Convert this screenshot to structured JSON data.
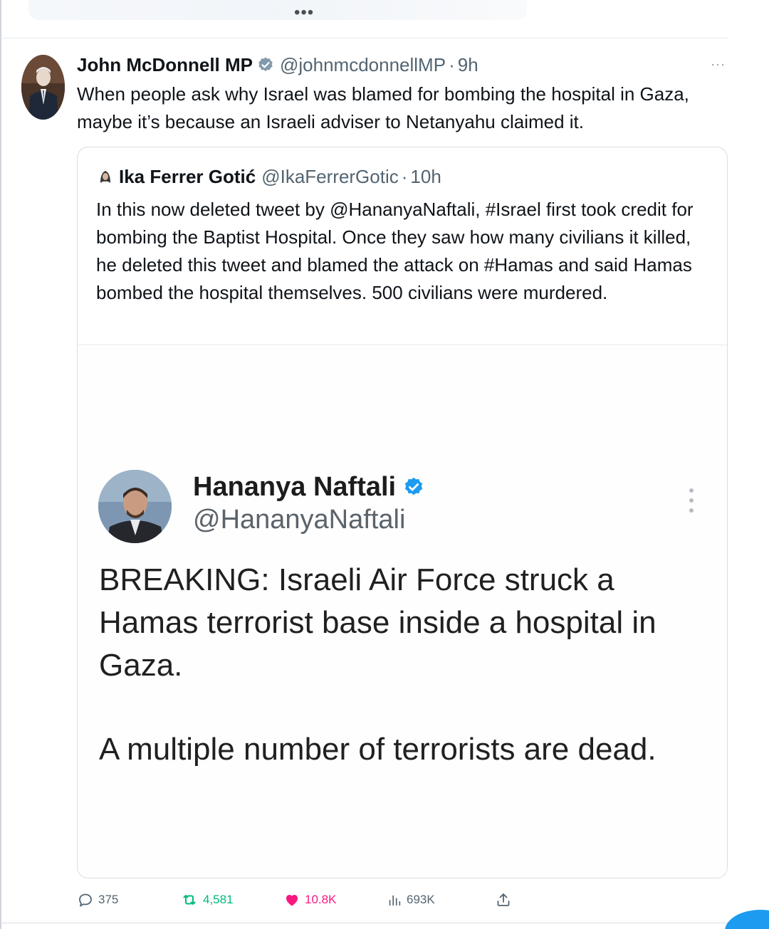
{
  "timeline": {
    "more_top_label": "•••"
  },
  "tweet": {
    "author_name": "John McDonnell MP",
    "handle": "@johnmcdonnellMP",
    "separator": "·",
    "time": "9h",
    "more_label": "···",
    "text": "When people ask why Israel was blamed for bombing the hospital in Gaza, maybe it’s because an Israeli adviser to Netanyahu claimed it.",
    "verified_color": "#829aab"
  },
  "quote": {
    "author_name": "Ika Ferrer Gotić",
    "handle": "@IkaFerrerGotic",
    "separator": "·",
    "time": "10h",
    "text": "In this now deleted tweet by @HananyaNaftali, #Israel first took credit for bombing the Baptist Hospital. Once they saw how many civilians it killed, he deleted this tweet and blamed the attack on #Hamas and said Hamas bombed the hospital themselves. 500 civilians were murdered.",
    "embedded_tweet": {
      "author_name": "Hananya Naftali",
      "handle": "@HananyaNaftali",
      "paragraph_1": "BREAKING: Israeli Air Force struck a Hamas terrorist base inside a hospital in Gaza.",
      "paragraph_2": "A multiple number of terrorists are dead.",
      "verified_color": "#1d9bf0"
    }
  },
  "actions": {
    "replies": "375",
    "retweets": "4,581",
    "likes": "10.8K",
    "views": "693K",
    "retweet_color": "#00ba7c",
    "like_color": "#f91880"
  },
  "icons": {
    "reply": "reply-icon",
    "retweet": "retweet-icon",
    "like": "heart-icon",
    "views": "views-chart-icon",
    "share": "share-icon",
    "verified": "verified-badge-icon"
  }
}
